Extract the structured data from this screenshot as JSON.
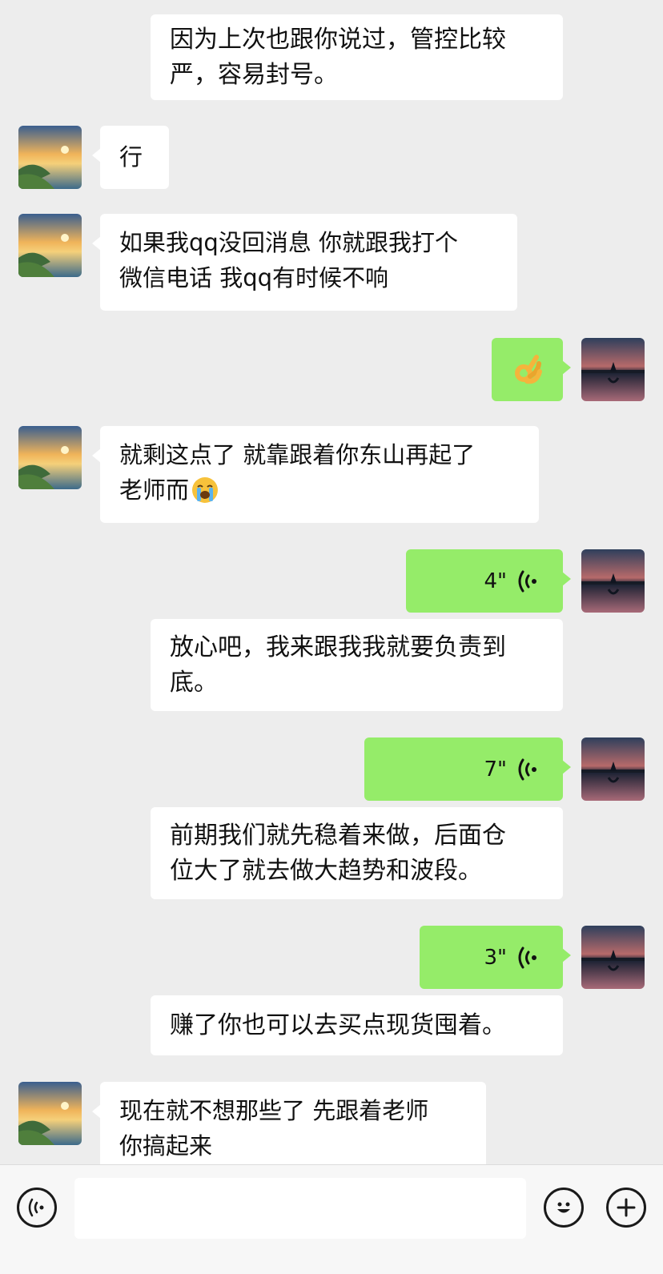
{
  "messages": {
    "m1": {
      "side": "received",
      "text_line1": "因为上次也跟你说过，管控比较",
      "text_line2": "严，容易封号。"
    },
    "m2": {
      "side": "contact",
      "text": "行"
    },
    "m3": {
      "side": "contact",
      "text_line1": "如果我qq没回消息 你就跟我打个",
      "text_line2": "微信电话 我qq有时候不响"
    },
    "m4": {
      "side": "me",
      "emoji": "ok-hand-emoji"
    },
    "m5": {
      "side": "contact",
      "text_line1": "就剩这点了 就靠跟着你东山再起了",
      "text_line2": "老师而"
    },
    "m6": {
      "side": "me",
      "voice_duration": "4\""
    },
    "m6_text": {
      "text_line1": "放心吧，我来跟我我就要负责到",
      "text_line2": "底。"
    },
    "m7": {
      "side": "me",
      "voice_duration": "7\""
    },
    "m7_text": {
      "text_line1": "前期我们就先稳着来做，后面仓",
      "text_line2": "位大了就去做大趋势和波段。"
    },
    "m8": {
      "side": "me",
      "voice_duration": "3\""
    },
    "m8_text": {
      "text": "赚了你也可以去买点现货囤着。"
    },
    "m9": {
      "side": "contact",
      "text_line1": "现在就不想那些了 先跟着老师",
      "text_line2": "你搞起来"
    }
  },
  "bottom_bar": {
    "voice_button_icon": "voice-mode-icon",
    "emoji_button_icon": "emoji-icon",
    "plus_button_icon": "plus-icon",
    "input_value": ""
  },
  "colors": {
    "background": "#ededed",
    "sent_bubble": "#95ec69",
    "received_bubble": "#ffffff"
  }
}
